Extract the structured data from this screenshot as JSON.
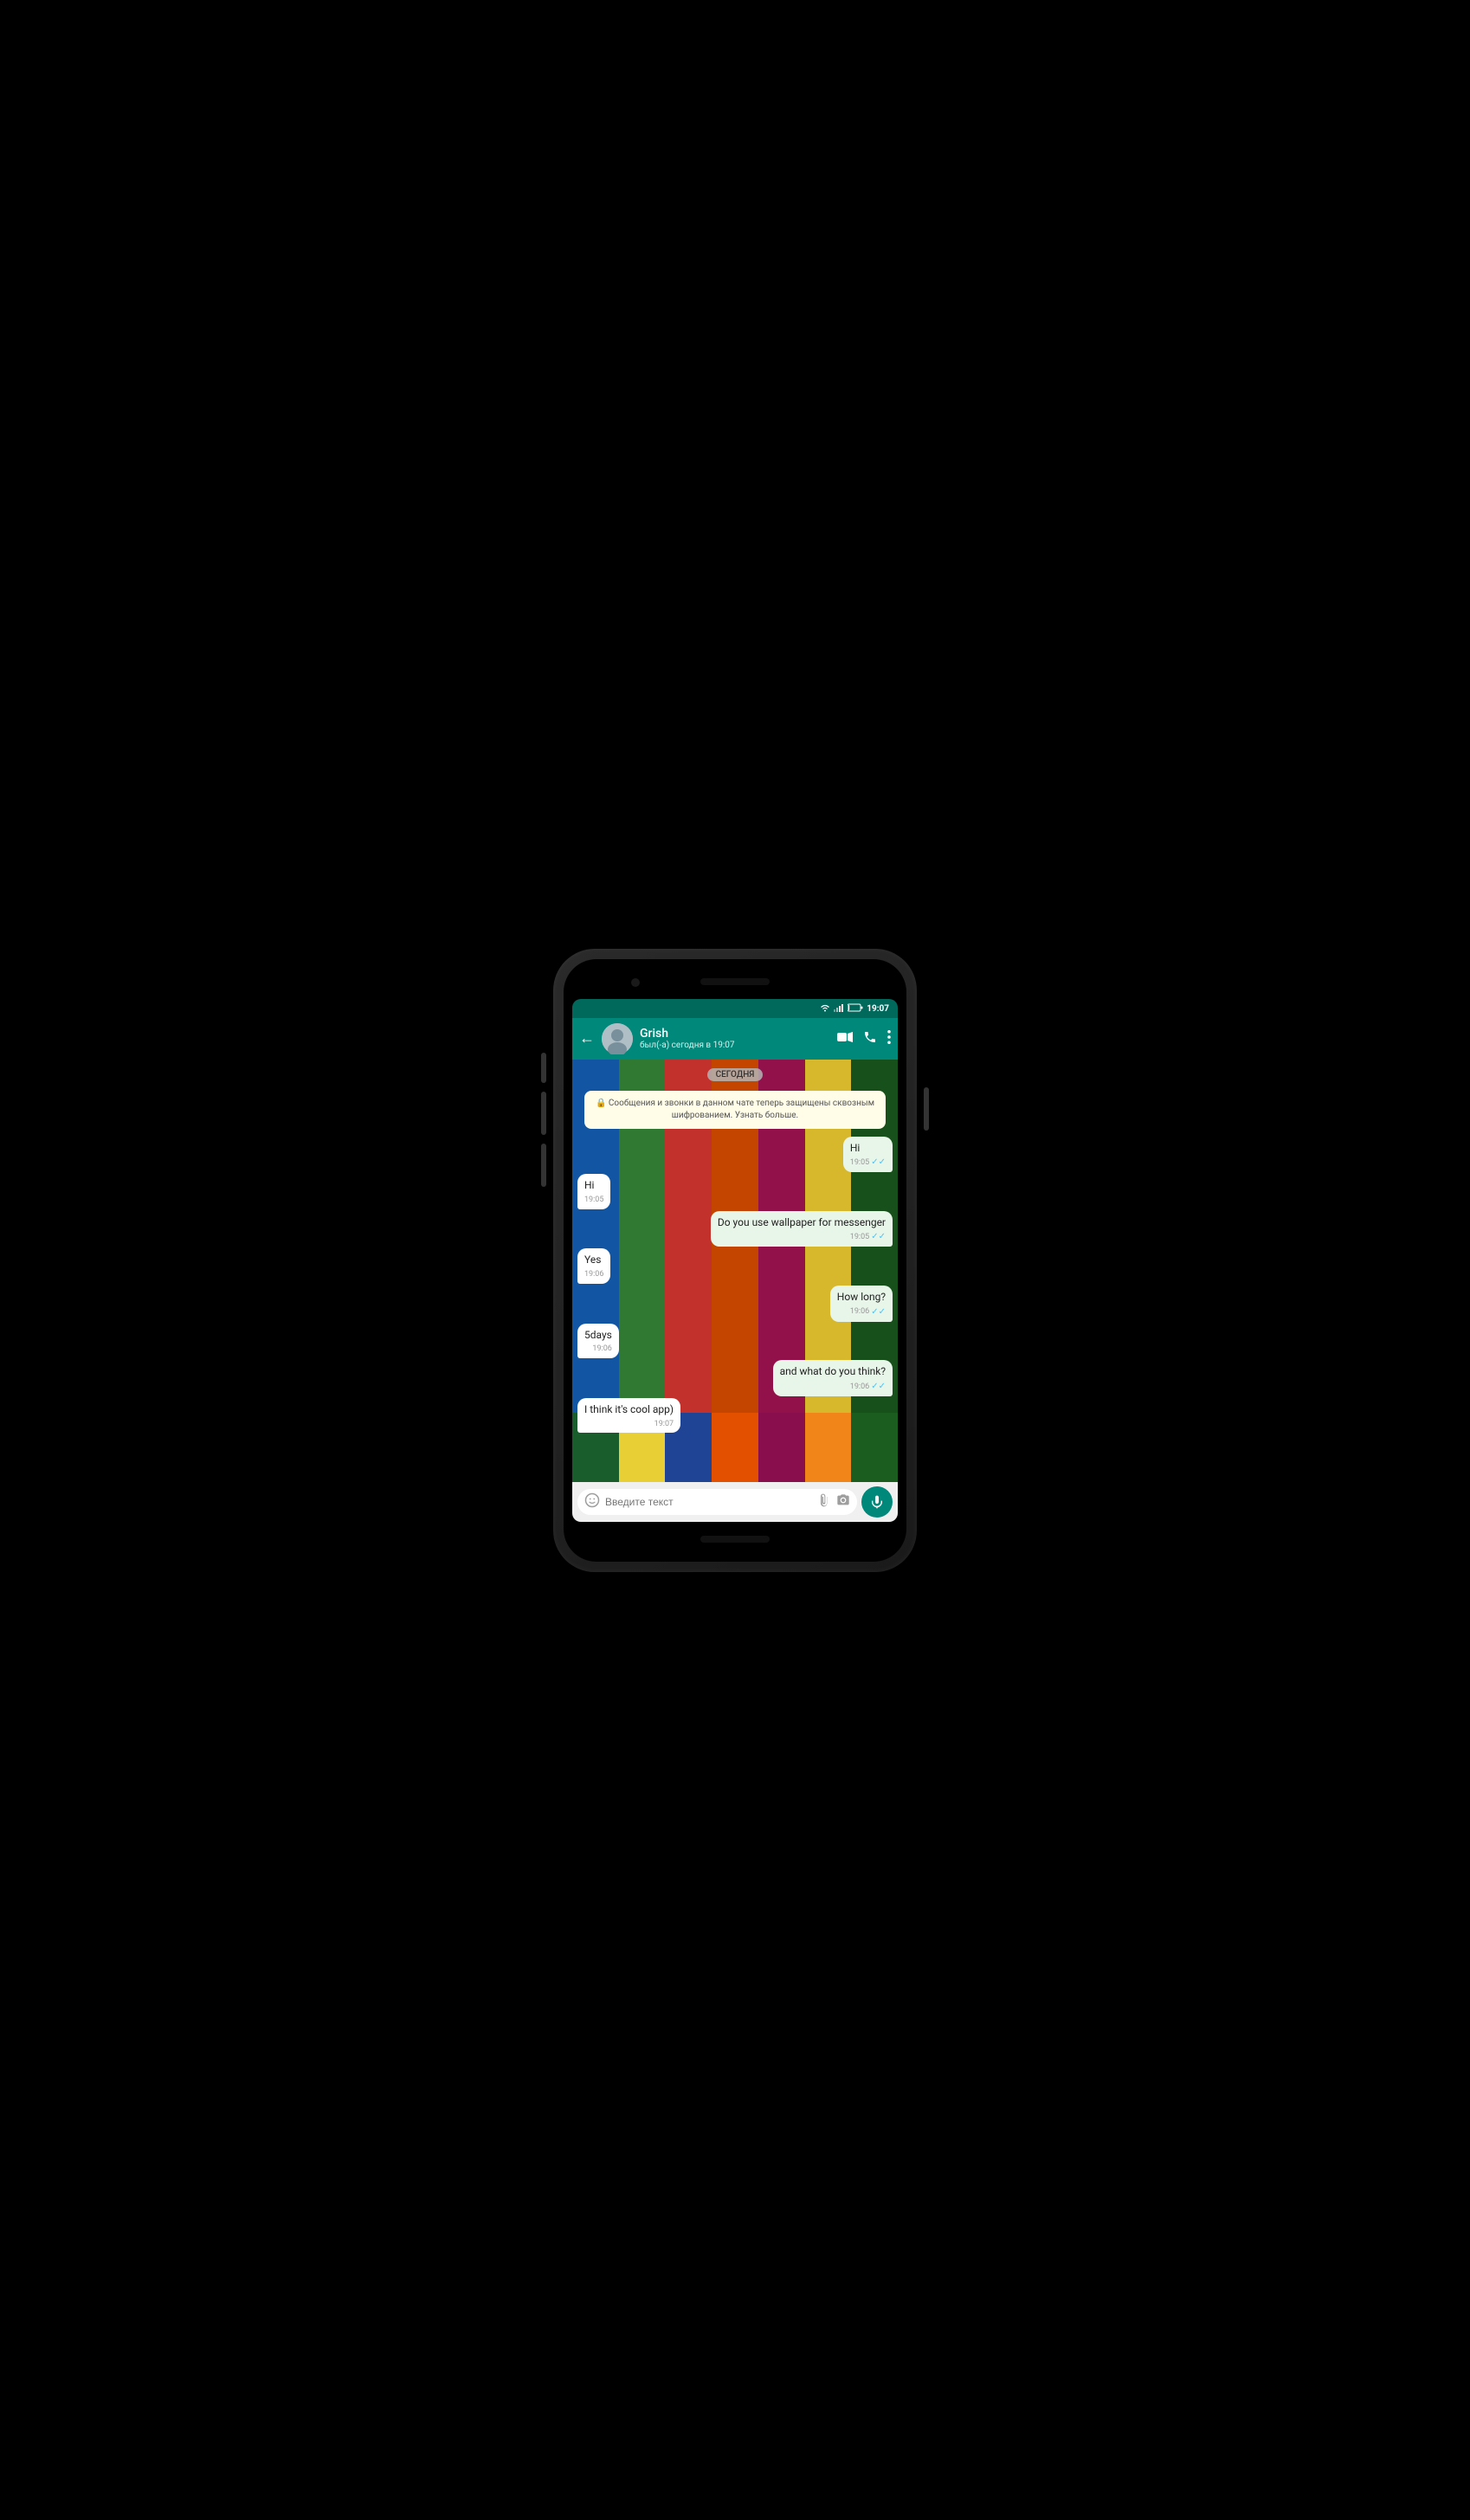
{
  "phone": {
    "status_bar": {
      "wifi": "📶",
      "signal": "📶",
      "battery": "8%",
      "time": "19:07"
    },
    "header": {
      "back_label": "←",
      "contact_name": "Grish",
      "contact_status": "был(-а) сегодня в 19:07",
      "video_icon": "🎥",
      "call_icon": "📞",
      "menu_icon": "⋮"
    },
    "date_badge": "СЕГОДНЯ",
    "encryption_notice": "🔒 Сообщения и звонки в данном чате теперь защищены сквозным шифрованием. Узнать больше.",
    "messages": [
      {
        "id": 1,
        "type": "sent",
        "text": "Hi",
        "time": "19:05",
        "ticks": "✓✓"
      },
      {
        "id": 2,
        "type": "received",
        "text": "Hi",
        "time": "19:05",
        "ticks": ""
      },
      {
        "id": 3,
        "type": "sent",
        "text": "Do you use wallpaper for messenger",
        "time": "19:05",
        "ticks": "✓✓"
      },
      {
        "id": 4,
        "type": "received",
        "text": "Yes",
        "time": "19:06",
        "ticks": ""
      },
      {
        "id": 5,
        "type": "sent",
        "text": "How long?",
        "time": "19:06",
        "ticks": "✓✓"
      },
      {
        "id": 6,
        "type": "received",
        "text": "5days",
        "time": "19:06",
        "ticks": ""
      },
      {
        "id": 7,
        "type": "sent",
        "text": "and what do you think?",
        "time": "19:06",
        "ticks": "✓✓"
      },
      {
        "id": 8,
        "type": "received",
        "text": "I think it's cool app)",
        "time": "19:07",
        "ticks": ""
      }
    ],
    "input": {
      "placeholder": "Введите текст"
    }
  },
  "wallpaper_stripes": [
    "#1565c0",
    "#388e3c",
    "#e53935",
    "#e65100",
    "#ad1457",
    "#fdd835",
    "#1b5e20"
  ],
  "floor_tiles": [
    "#1b5e20",
    "#fdd835",
    "#0d47a1",
    "#e65100",
    "#880e4f",
    "#f57f17",
    "#1b5e20"
  ]
}
